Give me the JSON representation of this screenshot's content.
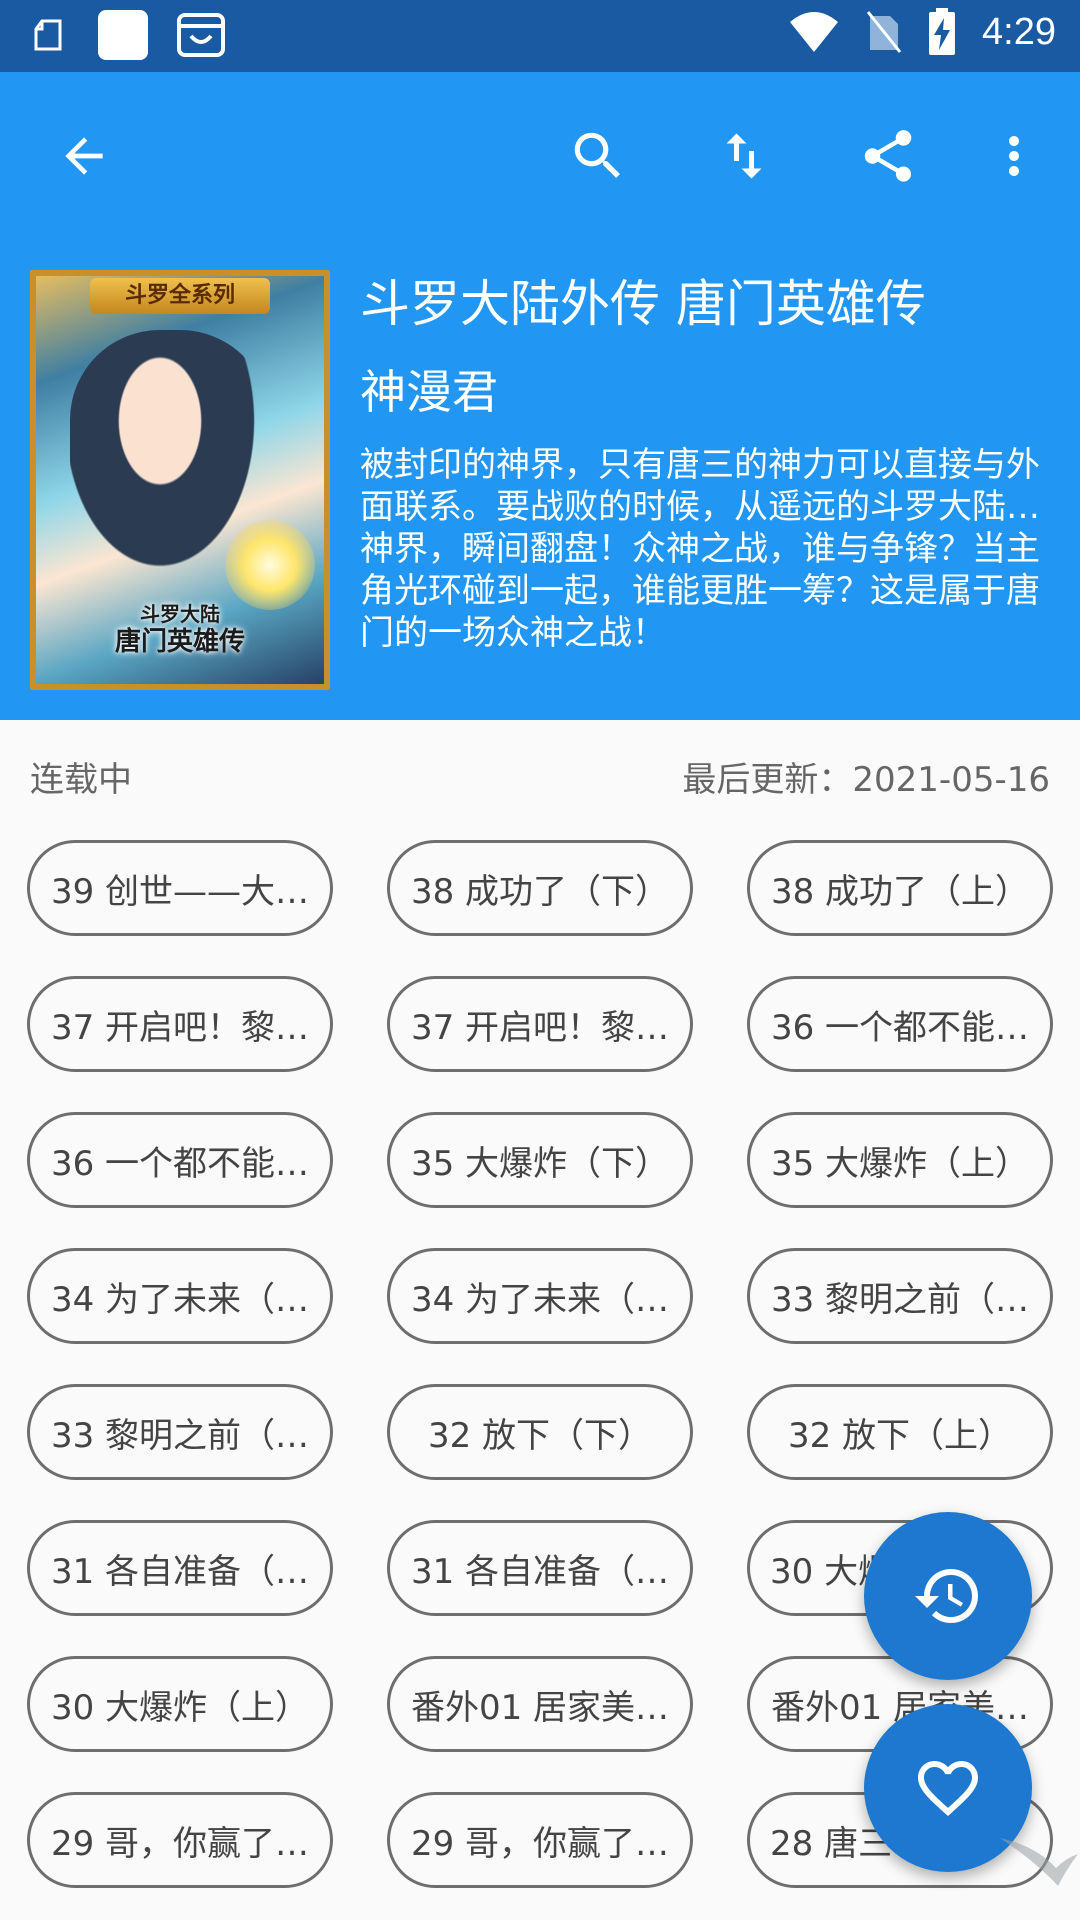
{
  "status_bar": {
    "time": "4:29"
  },
  "toolbar": {
    "back_icon": "arrow-back-icon",
    "search_icon": "search-icon",
    "sort_icon": "swap-vertical-icon",
    "share_icon": "share-icon",
    "more_icon": "more-vert-icon"
  },
  "book": {
    "cover_banner": "斗罗全系列",
    "cover_logo_line1": "斗罗大陆",
    "cover_logo_line2": "唐门英雄传",
    "title": "斗罗大陆外传 唐门英雄传",
    "author": "神漫君",
    "description": "被封印的神界，只有唐三的神力可以直接与外面联系。要战败的时候，从遥远的斗罗大陆…神界，瞬间翻盘！众神之战，谁与争锋？当主角光环碰到一起，谁能更胜一筹？这是属于唐门的一场众神之战！"
  },
  "info": {
    "status": "连载中",
    "last_update": "最后更新：2021-05-16"
  },
  "chapters": [
    "39 创世——大…",
    "38 成功了（下）",
    "38 成功了（上）",
    "37 开启吧！黎…",
    "37 开启吧！黎…",
    "36 一个都不能…",
    "36 一个都不能…",
    "35 大爆炸（下）",
    "35 大爆炸（上）",
    "34 为了未来（…",
    "34 为了未来（…",
    "33 黎明之前（…",
    "33 黎明之前（…",
    "32 放下（下）",
    "32 放下（上）",
    "31 各自准备（…",
    "31 各自准备（…",
    "30 大爆",
    "30 大爆炸（上）",
    "番外01 居家美…",
    "番外01 居家美…",
    "29 哥，你赢了…",
    "29 哥，你赢了…",
    "28 唐三"
  ],
  "fabs": {
    "history_icon": "history-icon",
    "favorite_icon": "heart-outline-icon"
  },
  "colors": {
    "status_bar": "#1a5aa3",
    "app_bar": "#2196f3",
    "fab": "#1e78d0",
    "chip_border": "#6e6e6e"
  }
}
